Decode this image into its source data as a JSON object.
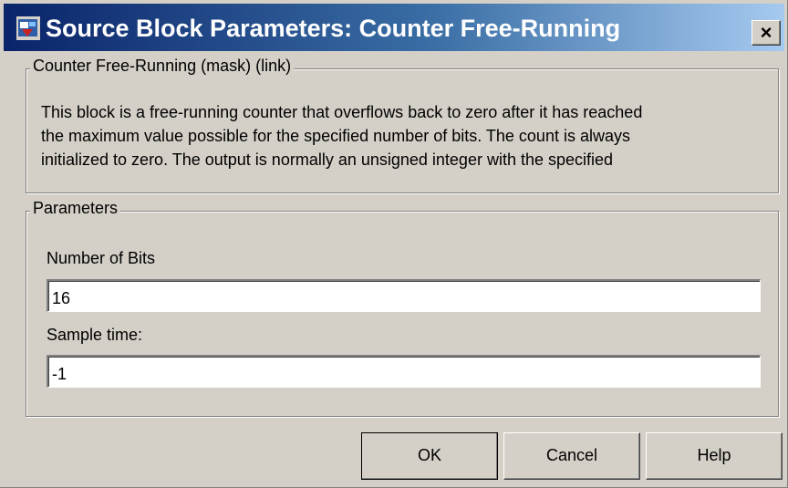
{
  "window": {
    "title": "Source Block Parameters: Counter Free-Running",
    "close_label": "×"
  },
  "description": {
    "legend": "Counter Free-Running (mask) (link)",
    "lines": [
      "This block is a free-running counter that overflows back to zero after it has reached",
      "the maximum value possible for the specified number of bits. The count is always",
      "initialized to zero.  The output is normally an unsigned integer with the specified"
    ]
  },
  "parameters": {
    "legend": "Parameters",
    "number_of_bits": {
      "label": "Number of Bits",
      "value": "16"
    },
    "sample_time": {
      "label": "Sample time:",
      "value": "-1"
    }
  },
  "buttons": {
    "ok": "OK",
    "cancel": "Cancel",
    "help": "Help"
  },
  "colors": {
    "title_gradient_start": "#0a246a",
    "title_gradient_end": "#a6caf0",
    "dialog_face": "#d4d0c8"
  },
  "icons": {
    "app_icon": "simulink-block-icon",
    "close_icon": "close-icon"
  }
}
